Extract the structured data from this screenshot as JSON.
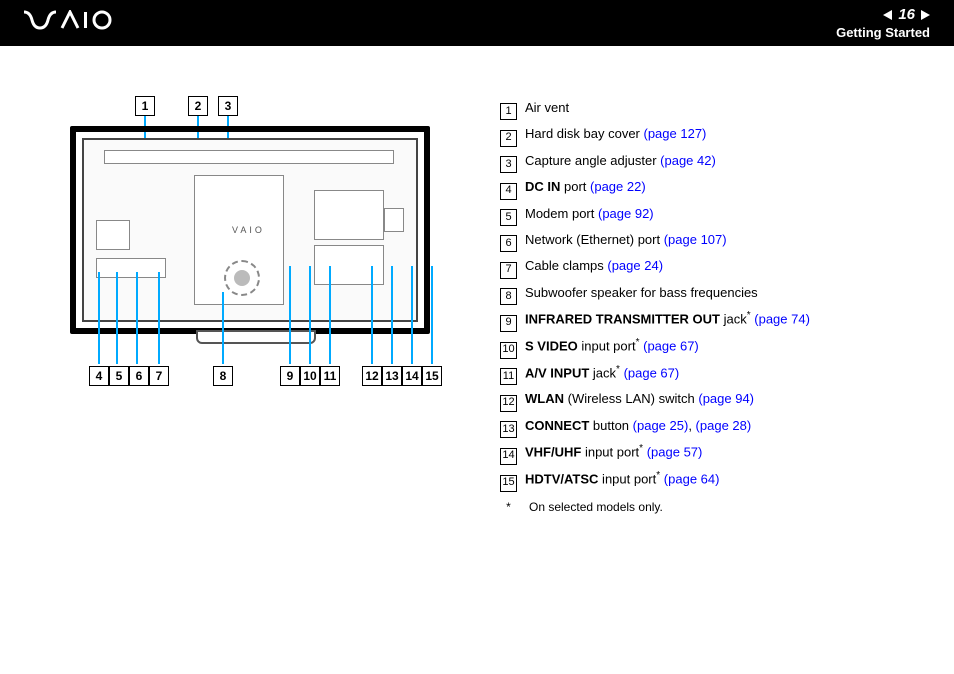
{
  "header": {
    "logo_text": "VAIO",
    "page_number": "16",
    "section": "Getting Started"
  },
  "callouts_top": [
    "1",
    "2",
    "3"
  ],
  "callouts_bottom": [
    "4",
    "5",
    "6",
    "7",
    "8",
    "9",
    "10",
    "11",
    "12",
    "13",
    "14",
    "15"
  ],
  "diagram_logo": "VAIO",
  "legend": [
    {
      "num": "1",
      "text": "Air vent",
      "bold": "",
      "link": "",
      "asterisk": false
    },
    {
      "num": "2",
      "text": "Hard disk bay cover ",
      "bold": "",
      "link": "(page 127)",
      "asterisk": false
    },
    {
      "num": "3",
      "text": "Capture angle adjuster ",
      "bold": "",
      "link": "(page 42)",
      "asterisk": false
    },
    {
      "num": "4",
      "bold": "DC IN",
      "text": " port ",
      "link": "(page 22)",
      "asterisk": false
    },
    {
      "num": "5",
      "text": "Modem port ",
      "bold": "",
      "link": "(page 92)",
      "asterisk": false
    },
    {
      "num": "6",
      "text": "Network (Ethernet) port ",
      "bold": "",
      "link": "(page 107)",
      "asterisk": false
    },
    {
      "num": "7",
      "text": "Cable clamps ",
      "bold": "",
      "link": "(page 24)",
      "asterisk": false
    },
    {
      "num": "8",
      "text": "Subwoofer speaker for bass frequencies",
      "bold": "",
      "link": "",
      "asterisk": false
    },
    {
      "num": "9",
      "bold": "INFRARED TRANSMITTER OUT",
      "text": " jack",
      "link": "(page 74)",
      "asterisk": true
    },
    {
      "num": "10",
      "bold": "S VIDEO",
      "text": " input port",
      "link": "(page 67)",
      "asterisk": true
    },
    {
      "num": "11",
      "bold": "A/V INPUT",
      "text": " jack",
      "link": "(page 67)",
      "asterisk": true
    },
    {
      "num": "12",
      "bold": "WLAN",
      "text": " (Wireless LAN) switch ",
      "link": "(page 94)",
      "asterisk": false
    },
    {
      "num": "13",
      "bold": "CONNECT",
      "text": " button ",
      "link": "(page 25)",
      "link2": "(page 28)",
      "asterisk": false
    },
    {
      "num": "14",
      "bold": "VHF/UHF",
      "text": " input port",
      "link": "(page 57)",
      "asterisk": true
    },
    {
      "num": "15",
      "bold": "HDTV/ATSC",
      "text": " input port",
      "link": "(page 64)",
      "asterisk": true
    }
  ],
  "footnote": {
    "star": "*",
    "text": "On selected models only."
  }
}
